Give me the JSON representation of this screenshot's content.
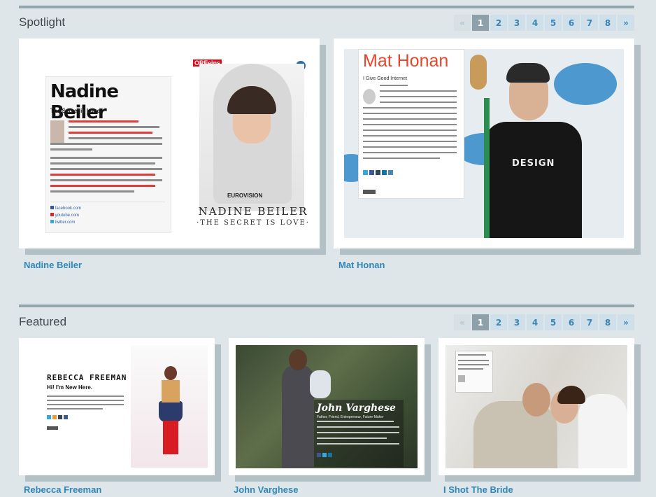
{
  "spotlight": {
    "title": "Spotlight",
    "pager": {
      "prev": "«",
      "next": "»",
      "pages": [
        "1",
        "2",
        "3",
        "4",
        "5",
        "6",
        "7",
        "8"
      ],
      "active": "1"
    },
    "cards": [
      {
        "caption": "Nadine Beiler",
        "thumb": {
          "name": "Nadine Beiler",
          "subtitle": "The Secret is Loue",
          "links": [
            "facebook.com",
            "youtube.com",
            "twitter.com"
          ],
          "badge": "ORFeins",
          "cover_title": "NADINE BEILER",
          "cover_subtitle": "·THE SECRET IS LOVE·",
          "eurovision": "EUROVISION"
        }
      },
      {
        "caption": "Mat Honan",
        "thumb": {
          "name": "Mat Honan",
          "subtitle": "I Give Good Internet",
          "shirt_text": "DESIGN"
        }
      }
    ]
  },
  "featured": {
    "title": "Featured",
    "pager": {
      "prev": "«",
      "next": "»",
      "pages": [
        "1",
        "2",
        "3",
        "4",
        "5",
        "6",
        "7",
        "8"
      ],
      "active": "1"
    },
    "cards": [
      {
        "caption": "Rebecca Freeman",
        "thumb": {
          "name": "REBECCA FREEMAN",
          "subtitle": "Hi! I'm New Here."
        }
      },
      {
        "caption": "John Varghese",
        "thumb": {
          "name": "John Varghese",
          "subtitle": "Father, Friend, Entrepreneur, Future-Maker"
        }
      },
      {
        "caption": "I Shot The Bride",
        "thumb": {}
      }
    ]
  },
  "colors": {
    "background": "#dfe6e9",
    "link": "#2f86b8",
    "pager_bg": "#cfe0ea",
    "pager_active": "#8ea0aa",
    "accent_red": "#e8462a"
  }
}
